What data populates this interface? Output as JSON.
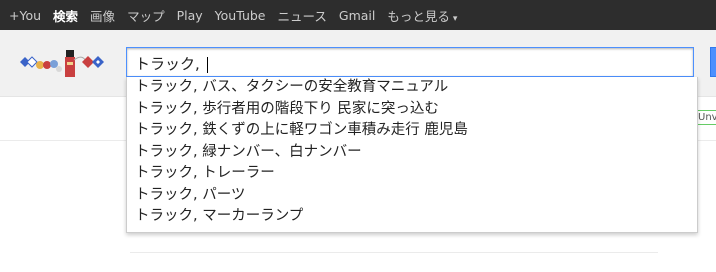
{
  "gbar": {
    "links": [
      "+You",
      "検索",
      "画像",
      "マップ",
      "Play",
      "YouTube",
      "ニュース",
      "Gmail",
      "もっと見る"
    ],
    "active_index": 1,
    "more_caret": "▾"
  },
  "search": {
    "query": "トラック, "
  },
  "suggestions": [
    "トラック, バス、タクシーの安全教育マニュアル",
    "トラック, 歩行者用の階段下り 民家に突っ込む",
    "トラック, 鉄くずの上に軽ワゴン車積み走行 鹿児島",
    "トラック, 緑ナンバー、白ナンバー",
    "トラック, トレーラー",
    "トラック, パーツ",
    "トラック, マーカーランプ"
  ],
  "right_badge": "Unv"
}
